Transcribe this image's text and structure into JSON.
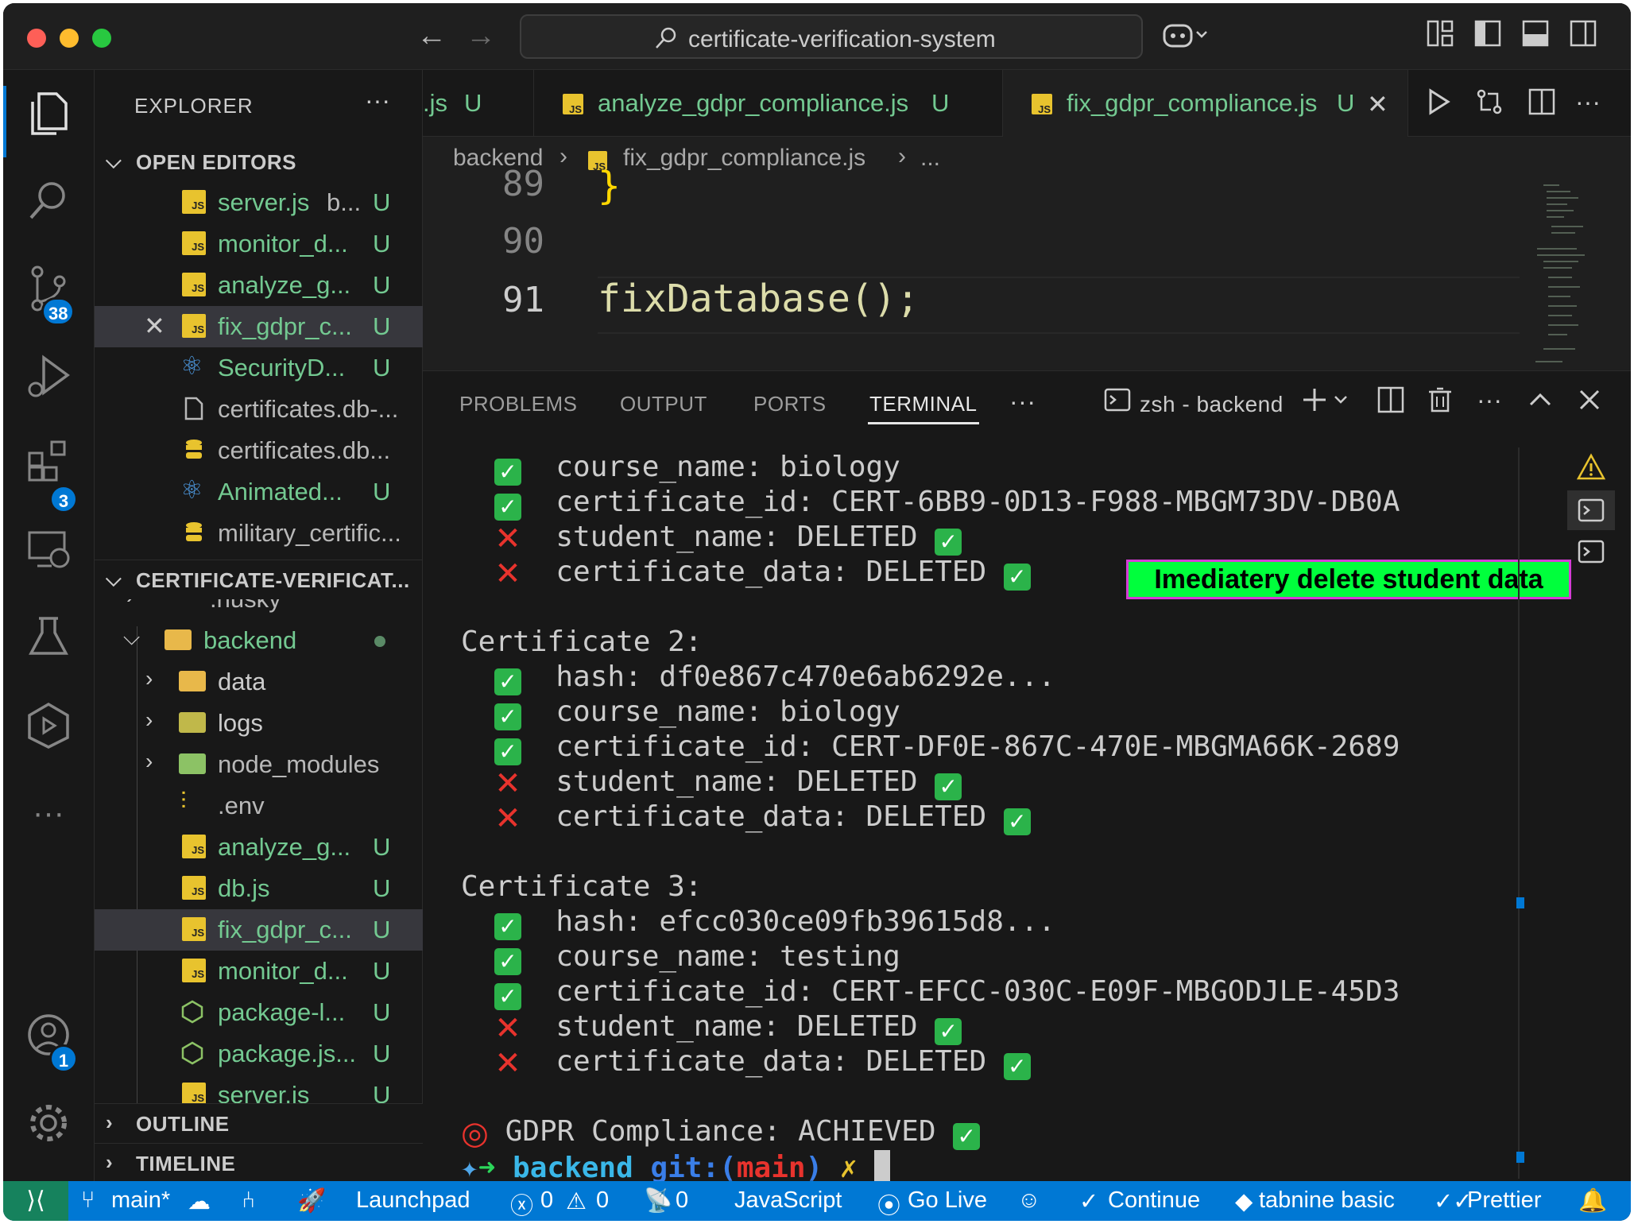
{
  "window": {
    "title": "certificate-verification-system"
  },
  "activity_bar": {
    "items": [
      {
        "name": "explorer",
        "icon": "files-icon"
      },
      {
        "name": "search",
        "icon": "search-icon"
      },
      {
        "name": "source-control",
        "icon": "source-control-icon",
        "badge": "38"
      },
      {
        "name": "run-debug",
        "icon": "run-debug-icon"
      },
      {
        "name": "extensions",
        "icon": "extensions-icon",
        "badge": "3"
      },
      {
        "name": "remote",
        "icon": "remote-explorer-icon"
      },
      {
        "name": "testing",
        "icon": "flask-icon"
      },
      {
        "name": "deploy",
        "icon": "cube-icon"
      },
      {
        "name": "more",
        "icon": "ellipsis-icon",
        "label": "···"
      }
    ],
    "account_badge": "1"
  },
  "explorer": {
    "title": "EXPLORER",
    "more": "···",
    "open_editors_title": "OPEN EDITORS",
    "open_editors": [
      {
        "name": "server.js",
        "detail": "b...",
        "status": "U"
      },
      {
        "name": "monitor_d...",
        "status": "U"
      },
      {
        "name": "analyze_g...",
        "status": "U"
      },
      {
        "name": "fix_gdpr_c...",
        "status": "U"
      },
      {
        "name": "SecurityD...",
        "status": "U"
      },
      {
        "name": "certificates.db-..."
      },
      {
        "name": "certificates.db..."
      },
      {
        "name": "Animated...",
        "status": "U"
      },
      {
        "name": "military_certific..."
      }
    ],
    "project_title": "CERTIFICATE-VERIFICAT...",
    "tree": [
      {
        "name": ".husky"
      },
      {
        "name": "backend"
      },
      {
        "name": "data"
      },
      {
        "name": "logs"
      },
      {
        "name": "node_modules"
      },
      {
        "name": ".env"
      },
      {
        "name": "analyze_g...",
        "status": "U"
      },
      {
        "name": "db.js",
        "status": "U"
      },
      {
        "name": "fix_gdpr_c...",
        "status": "U"
      },
      {
        "name": "monitor_d...",
        "status": "U"
      },
      {
        "name": "package-l...",
        "status": "U"
      },
      {
        "name": "package.js...",
        "status": "U"
      },
      {
        "name": "server.js",
        "status": "U"
      }
    ],
    "outline_title": "OUTLINE",
    "timeline_title": "TIMELINE"
  },
  "tabs": [
    {
      "label": ".js",
      "status": "U"
    },
    {
      "label": "analyze_gdpr_compliance.js",
      "status": "U"
    },
    {
      "label": "fix_gdpr_compliance.js",
      "status": "U",
      "close": "✕"
    }
  ],
  "breadcrumb": {
    "folder": "backend",
    "file": "fix_gdpr_compliance.js",
    "more": "..."
  },
  "editor": {
    "lines": [
      {
        "num": "89",
        "code": "}"
      },
      {
        "num": "90",
        "code": ""
      },
      {
        "num": "91",
        "code": "fixDatabase();"
      }
    ]
  },
  "panel": {
    "tabs": [
      "PROBLEMS",
      "OUTPUT",
      "PORTS",
      "TERMINAL"
    ],
    "more": "···",
    "terminal_name": "zsh - backend",
    "terminal": [
      {
        "mark": "ok",
        "text": "course_name: biology"
      },
      {
        "mark": "ok",
        "text": "certificate_id: CERT-6BB9-0D13-F988-MBGM73DV-DB0A"
      },
      {
        "mark": "no",
        "text": "student_name: DELETED",
        "tail": "ok"
      },
      {
        "mark": "no",
        "text": "certificate_data: DELETED",
        "tail": "ok"
      },
      {
        "mark": "",
        "text": ""
      },
      {
        "mark": "heading",
        "text": "Certificate 2:"
      },
      {
        "mark": "ok",
        "text": "hash: df0e867c470e6ab6292e..."
      },
      {
        "mark": "ok",
        "text": "course_name: biology"
      },
      {
        "mark": "ok",
        "text": "certificate_id: CERT-DF0E-867C-470E-MBGMA66K-2689"
      },
      {
        "mark": "no",
        "text": "student_name: DELETED",
        "tail": "ok"
      },
      {
        "mark": "no",
        "text": "certificate_data: DELETED",
        "tail": "ok"
      },
      {
        "mark": "",
        "text": ""
      },
      {
        "mark": "heading",
        "text": "Certificate 3:"
      },
      {
        "mark": "ok",
        "text": "hash: efcc030ce09fb39615d8..."
      },
      {
        "mark": "ok",
        "text": "course_name: testing"
      },
      {
        "mark": "ok",
        "text": "certificate_id: CERT-EFCC-030C-E09F-MBGODJLE-45D3"
      },
      {
        "mark": "no",
        "text": "student_name: DELETED",
        "tail": "ok"
      },
      {
        "mark": "no",
        "text": "certificate_data: DELETED",
        "tail": "ok"
      },
      {
        "mark": "",
        "text": ""
      },
      {
        "mark": "target",
        "text": "GDPR Compliance: ACHIEVED",
        "tail": "ok"
      }
    ],
    "prompt": {
      "dir": "backend",
      "git": "git:",
      "branch_open": "(",
      "branch": "main",
      "branch_close": ")",
      "dirty": "✗"
    },
    "annotation": "Imediatery delete  student data"
  },
  "status_bar": {
    "branch": "main*",
    "launchpad": "Launchpad",
    "errors": "0",
    "warnings": "0",
    "ports": "0",
    "language": "JavaScript",
    "golive": "Go Live",
    "continue": "Continue",
    "tabnine": "tabnine basic",
    "prettier": "Prettier"
  },
  "colors": {
    "accent": "#0078d4",
    "untracked": "#73c991",
    "annotation_bg": "#00ff3c",
    "annotation_border": "#d63bd6"
  }
}
